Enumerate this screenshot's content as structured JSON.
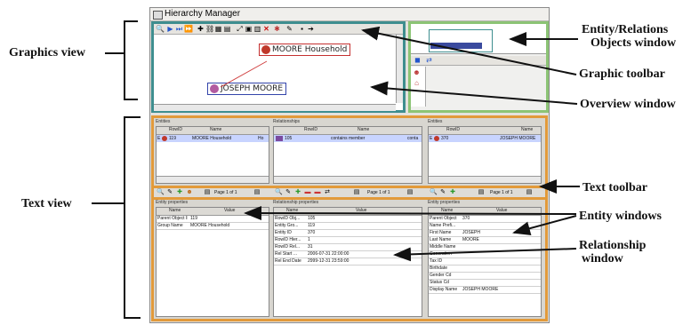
{
  "callouts": {
    "graphics_view": "Graphics view",
    "text_view": "Text view",
    "entity_relations_line1": "Entity/Relations",
    "entity_relations_line2": "Objects window",
    "graphic_toolbar": "Graphic toolbar",
    "overview_window": "Overview window",
    "text_toolbar": "Text toolbar",
    "entity_windows": "Entity windows",
    "relationship_line1": "Relationship",
    "relationship_line2": "window"
  },
  "window": {
    "title": "Hierarchy Manager"
  },
  "graphics": {
    "node_household": "MOORE Household",
    "node_person": "JOSEPH MOORE"
  },
  "colors": {
    "graphics_frame": "#3e8e8f",
    "overview_frame": "#8cc475",
    "text_frame": "#e29a3a"
  },
  "entities_left": {
    "title": "Entities",
    "columns": [
      "RowID",
      "Name"
    ],
    "rows": [
      {
        "marker": "E",
        "rowid": "119",
        "name": "MOORE Household",
        "extra": "Ho"
      }
    ],
    "pager": "Page 1 of 1",
    "props_title": "Entity properties",
    "props_columns": [
      "Name",
      "Value"
    ],
    "props": [
      {
        "k": "Parent Object ID",
        "v": "119"
      },
      {
        "k": "Group Name",
        "v": "MOORE Household"
      }
    ]
  },
  "relationships": {
    "title": "Relationships",
    "columns": [
      "RowID",
      "Name"
    ],
    "rows": [
      {
        "rowid": "105",
        "name": "contains member",
        "extra": "conta"
      }
    ],
    "pager": "Page 1 of 1",
    "props_title": "Relationship properties",
    "props_columns": [
      "Name",
      "Value"
    ],
    "props": [
      {
        "k": "RowID Obj...",
        "v": "105"
      },
      {
        "k": "Entity Gro...",
        "v": "119"
      },
      {
        "k": "Entity ID",
        "v": "370"
      },
      {
        "k": "RowID Hier...",
        "v": "1"
      },
      {
        "k": "RowID Rel...",
        "v": "31"
      },
      {
        "k": "Rel Start ...",
        "v": "2006-07-31 22:00:00"
      },
      {
        "k": "Rel End Date",
        "v": "2999-12-31 23:59:00"
      }
    ]
  },
  "entities_right": {
    "title": "Entities",
    "columns": [
      "RowID",
      "Name"
    ],
    "rows": [
      {
        "marker": "E",
        "rowid": "370",
        "name": "JOSEPH MOORE"
      }
    ],
    "pager": "Page 1 of 1",
    "props_title": "Entity properties",
    "props_columns": [
      "Name",
      "Value"
    ],
    "props": [
      {
        "k": "Parent Object",
        "v": "370"
      },
      {
        "k": "Name Prefi...",
        "v": ""
      },
      {
        "k": "First Name",
        "v": "JOSEPH"
      },
      {
        "k": "Last Name",
        "v": "MOORE"
      },
      {
        "k": "Middle Name",
        "v": ""
      },
      {
        "k": "Generation",
        "v": ""
      },
      {
        "k": "Tax ID",
        "v": ""
      },
      {
        "k": "Birthdate",
        "v": ""
      },
      {
        "k": "Gender Cd",
        "v": ""
      },
      {
        "k": "Status Cd",
        "v": ""
      },
      {
        "k": "Display Name",
        "v": "JOSEPH MOORE"
      }
    ]
  }
}
